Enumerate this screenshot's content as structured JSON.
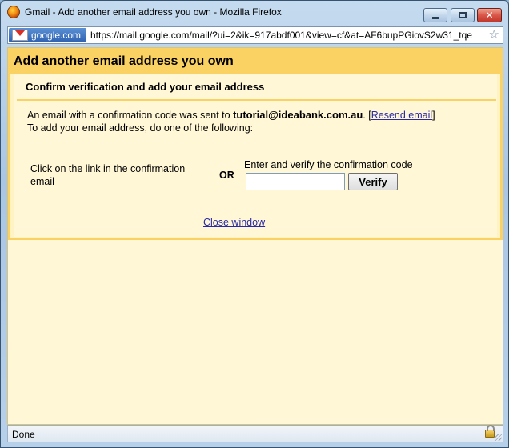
{
  "window": {
    "title": "Gmail - Add another email address you own - Mozilla Firefox"
  },
  "urlbar": {
    "site_identity": "google.com",
    "url": "https://mail.google.com/mail/?ui=2&ik=917abdf001&view=cf&at=AF6bupPGiovS2w31_tqe"
  },
  "dialog": {
    "title": "Add another email address you own",
    "subtitle": "Confirm verification and add your email address",
    "message_prefix": "An email with a confirmation code was sent to ",
    "email": "tutorial@ideabank.com.au",
    "message_suffix": ". [",
    "resend_link": "Resend email",
    "message_close_bracket": "]",
    "instruction": "To add your email address, do one of the following:",
    "option_link_text": "Click on the link in the confirmation email",
    "or_label": "OR",
    "option_code_label": "Enter and verify the confirmation code",
    "code_input_value": "",
    "verify_button": "Verify",
    "close_link": "Close window"
  },
  "statusbar": {
    "text": "Done"
  },
  "colors": {
    "dialog_header": "#fad163",
    "dialog_body": "#fff7d6",
    "link": "#2a2aa8"
  }
}
